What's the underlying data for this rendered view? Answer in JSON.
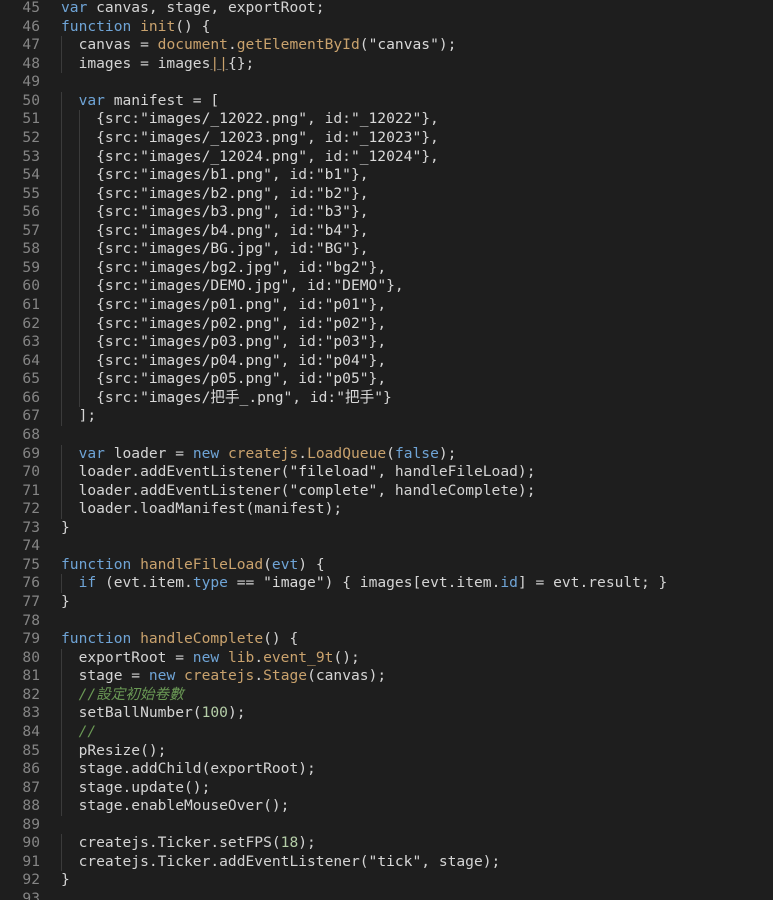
{
  "editor": {
    "colors": {
      "background": "#1e1e1e",
      "line_number": "#858585",
      "text": "#d4d4d4",
      "keyword": "#6fa4d6",
      "function": "#c9a26d",
      "number": "#b5cea8",
      "comment": "#6a9955"
    },
    "lines": [
      {
        "n": "45",
        "indent": 0,
        "tokens": [
          [
            "k",
            "var"
          ],
          [
            "i",
            " canvas, stage, exportRoot;"
          ]
        ]
      },
      {
        "n": "46",
        "indent": 0,
        "tokens": [
          [
            "k",
            "function"
          ],
          [
            "i",
            " "
          ],
          [
            "f",
            "init"
          ],
          [
            "p",
            "() {"
          ]
        ]
      },
      {
        "n": "47",
        "indent": 1,
        "tokens": [
          [
            "i",
            "  canvas = "
          ],
          [
            "f",
            "document"
          ],
          [
            "p",
            "."
          ],
          [
            "f",
            "getElementById"
          ],
          [
            "p",
            "("
          ],
          [
            "s",
            "\"canvas\""
          ],
          [
            "p",
            ");"
          ]
        ]
      },
      {
        "n": "48",
        "indent": 1,
        "tokens": [
          [
            "i",
            "  images = images"
          ],
          [
            "u",
            "||"
          ],
          [
            "p",
            "{};"
          ]
        ]
      },
      {
        "n": "49",
        "indent": 0,
        "tokens": []
      },
      {
        "n": "50",
        "indent": 1,
        "tokens": [
          [
            "i",
            "  "
          ],
          [
            "k",
            "var"
          ],
          [
            "i",
            " manifest = ["
          ]
        ]
      },
      {
        "n": "51",
        "indent": 2,
        "tokens": [
          [
            "i",
            "    {src:"
          ],
          [
            "s",
            "\"images/_12022.png\""
          ],
          [
            "i",
            ", id:"
          ],
          [
            "s",
            "\"_12022\""
          ],
          [
            "i",
            "},"
          ]
        ]
      },
      {
        "n": "52",
        "indent": 2,
        "tokens": [
          [
            "i",
            "    {src:"
          ],
          [
            "s",
            "\"images/_12023.png\""
          ],
          [
            "i",
            ", id:"
          ],
          [
            "s",
            "\"_12023\""
          ],
          [
            "i",
            "},"
          ]
        ]
      },
      {
        "n": "53",
        "indent": 2,
        "tokens": [
          [
            "i",
            "    {src:"
          ],
          [
            "s",
            "\"images/_12024.png\""
          ],
          [
            "i",
            ", id:"
          ],
          [
            "s",
            "\"_12024\""
          ],
          [
            "i",
            "},"
          ]
        ]
      },
      {
        "n": "54",
        "indent": 2,
        "tokens": [
          [
            "i",
            "    {src:"
          ],
          [
            "s",
            "\"images/b1.png\""
          ],
          [
            "i",
            ", id:"
          ],
          [
            "s",
            "\"b1\""
          ],
          [
            "i",
            "},"
          ]
        ]
      },
      {
        "n": "55",
        "indent": 2,
        "tokens": [
          [
            "i",
            "    {src:"
          ],
          [
            "s",
            "\"images/b2.png\""
          ],
          [
            "i",
            ", id:"
          ],
          [
            "s",
            "\"b2\""
          ],
          [
            "i",
            "},"
          ]
        ]
      },
      {
        "n": "56",
        "indent": 2,
        "tokens": [
          [
            "i",
            "    {src:"
          ],
          [
            "s",
            "\"images/b3.png\""
          ],
          [
            "i",
            ", id:"
          ],
          [
            "s",
            "\"b3\""
          ],
          [
            "i",
            "},"
          ]
        ]
      },
      {
        "n": "57",
        "indent": 2,
        "tokens": [
          [
            "i",
            "    {src:"
          ],
          [
            "s",
            "\"images/b4.png\""
          ],
          [
            "i",
            ", id:"
          ],
          [
            "s",
            "\"b4\""
          ],
          [
            "i",
            "},"
          ]
        ]
      },
      {
        "n": "58",
        "indent": 2,
        "tokens": [
          [
            "i",
            "    {src:"
          ],
          [
            "s",
            "\"images/BG.jpg\""
          ],
          [
            "i",
            ", id:"
          ],
          [
            "s",
            "\"BG\""
          ],
          [
            "i",
            "},"
          ]
        ]
      },
      {
        "n": "59",
        "indent": 2,
        "tokens": [
          [
            "i",
            "    {src:"
          ],
          [
            "s",
            "\"images/bg2.jpg\""
          ],
          [
            "i",
            ", id:"
          ],
          [
            "s",
            "\"bg2\""
          ],
          [
            "i",
            "},"
          ]
        ]
      },
      {
        "n": "60",
        "indent": 2,
        "tokens": [
          [
            "i",
            "    {src:"
          ],
          [
            "s",
            "\"images/DEMO.jpg\""
          ],
          [
            "i",
            ", id:"
          ],
          [
            "s",
            "\"DEMO\""
          ],
          [
            "i",
            "},"
          ]
        ]
      },
      {
        "n": "61",
        "indent": 2,
        "tokens": [
          [
            "i",
            "    {src:"
          ],
          [
            "s",
            "\"images/p01.png\""
          ],
          [
            "i",
            ", id:"
          ],
          [
            "s",
            "\"p01\""
          ],
          [
            "i",
            "},"
          ]
        ]
      },
      {
        "n": "62",
        "indent": 2,
        "tokens": [
          [
            "i",
            "    {src:"
          ],
          [
            "s",
            "\"images/p02.png\""
          ],
          [
            "i",
            ", id:"
          ],
          [
            "s",
            "\"p02\""
          ],
          [
            "i",
            "},"
          ]
        ]
      },
      {
        "n": "63",
        "indent": 2,
        "tokens": [
          [
            "i",
            "    {src:"
          ],
          [
            "s",
            "\"images/p03.png\""
          ],
          [
            "i",
            ", id:"
          ],
          [
            "s",
            "\"p03\""
          ],
          [
            "i",
            "},"
          ]
        ]
      },
      {
        "n": "64",
        "indent": 2,
        "tokens": [
          [
            "i",
            "    {src:"
          ],
          [
            "s",
            "\"images/p04.png\""
          ],
          [
            "i",
            ", id:"
          ],
          [
            "s",
            "\"p04\""
          ],
          [
            "i",
            "},"
          ]
        ]
      },
      {
        "n": "65",
        "indent": 2,
        "tokens": [
          [
            "i",
            "    {src:"
          ],
          [
            "s",
            "\"images/p05.png\""
          ],
          [
            "i",
            ", id:"
          ],
          [
            "s",
            "\"p05\""
          ],
          [
            "i",
            "},"
          ]
        ]
      },
      {
        "n": "66",
        "indent": 2,
        "tokens": [
          [
            "i",
            "    {src:"
          ],
          [
            "s",
            "\"images/把手_.png\""
          ],
          [
            "i",
            ", id:"
          ],
          [
            "s",
            "\"把手\""
          ],
          [
            "i",
            "}"
          ]
        ]
      },
      {
        "n": "67",
        "indent": 1,
        "tokens": [
          [
            "i",
            "  ];"
          ]
        ]
      },
      {
        "n": "68",
        "indent": 0,
        "tokens": []
      },
      {
        "n": "69",
        "indent": 1,
        "tokens": [
          [
            "i",
            "  "
          ],
          [
            "k",
            "var"
          ],
          [
            "i",
            " loader = "
          ],
          [
            "k",
            "new"
          ],
          [
            "i",
            " "
          ],
          [
            "f",
            "createjs"
          ],
          [
            "p",
            "."
          ],
          [
            "f",
            "LoadQueue"
          ],
          [
            "p",
            "("
          ],
          [
            "k",
            "false"
          ],
          [
            "p",
            ");"
          ]
        ]
      },
      {
        "n": "70",
        "indent": 1,
        "tokens": [
          [
            "i",
            "  loader.addEventListener("
          ],
          [
            "s",
            "\"fileload\""
          ],
          [
            "i",
            ", handleFileLoad);"
          ]
        ]
      },
      {
        "n": "71",
        "indent": 1,
        "tokens": [
          [
            "i",
            "  loader.addEventListener("
          ],
          [
            "s",
            "\"complete\""
          ],
          [
            "i",
            ", handleComplete);"
          ]
        ]
      },
      {
        "n": "72",
        "indent": 1,
        "tokens": [
          [
            "i",
            "  loader.loadManifest(manifest);"
          ]
        ]
      },
      {
        "n": "73",
        "indent": 0,
        "tokens": [
          [
            "i",
            "}"
          ]
        ]
      },
      {
        "n": "74",
        "indent": 0,
        "tokens": []
      },
      {
        "n": "75",
        "indent": 0,
        "tokens": [
          [
            "k",
            "function"
          ],
          [
            "i",
            " "
          ],
          [
            "f",
            "handleFileLoad"
          ],
          [
            "p",
            "("
          ],
          [
            "k",
            "evt"
          ],
          [
            "p",
            ") {"
          ]
        ]
      },
      {
        "n": "76",
        "indent": 1,
        "tokens": [
          [
            "i",
            "  "
          ],
          [
            "k",
            "if"
          ],
          [
            "i",
            " (evt.item."
          ],
          [
            "k",
            "type"
          ],
          [
            "i",
            " == "
          ],
          [
            "s",
            "\"image\""
          ],
          [
            "i",
            ") { images[evt.item."
          ],
          [
            "k",
            "id"
          ],
          [
            "i",
            "] = evt.result; }"
          ]
        ]
      },
      {
        "n": "77",
        "indent": 0,
        "tokens": [
          [
            "i",
            "}"
          ]
        ]
      },
      {
        "n": "78",
        "indent": 0,
        "tokens": []
      },
      {
        "n": "79",
        "indent": 0,
        "tokens": [
          [
            "k",
            "function"
          ],
          [
            "i",
            " "
          ],
          [
            "f",
            "handleComplete"
          ],
          [
            "p",
            "() {"
          ]
        ]
      },
      {
        "n": "80",
        "indent": 1,
        "tokens": [
          [
            "i",
            "  exportRoot = "
          ],
          [
            "k",
            "new"
          ],
          [
            "i",
            " "
          ],
          [
            "f",
            "lib"
          ],
          [
            "p",
            "."
          ],
          [
            "f",
            "event_9t"
          ],
          [
            "p",
            "();"
          ]
        ]
      },
      {
        "n": "81",
        "indent": 1,
        "tokens": [
          [
            "i",
            "  stage = "
          ],
          [
            "k",
            "new"
          ],
          [
            "i",
            " "
          ],
          [
            "f",
            "createjs"
          ],
          [
            "p",
            "."
          ],
          [
            "f",
            "Stage"
          ],
          [
            "p",
            "(canvas);"
          ]
        ]
      },
      {
        "n": "82",
        "indent": 1,
        "tokens": [
          [
            "i",
            "  "
          ],
          [
            "c",
            "//設定初始卷數"
          ]
        ]
      },
      {
        "n": "83",
        "indent": 1,
        "tokens": [
          [
            "i",
            "  setBallNumber("
          ],
          [
            "n",
            "100"
          ],
          [
            "i",
            ");"
          ]
        ]
      },
      {
        "n": "84",
        "indent": 1,
        "tokens": [
          [
            "i",
            "  "
          ],
          [
            "c",
            "//"
          ]
        ]
      },
      {
        "n": "85",
        "indent": 1,
        "tokens": [
          [
            "i",
            "  pResize();"
          ]
        ]
      },
      {
        "n": "86",
        "indent": 1,
        "tokens": [
          [
            "i",
            "  stage.addChild(exportRoot);"
          ]
        ]
      },
      {
        "n": "87",
        "indent": 1,
        "tokens": [
          [
            "i",
            "  stage.update();"
          ]
        ]
      },
      {
        "n": "88",
        "indent": 1,
        "tokens": [
          [
            "i",
            "  stage.enableMouseOver();"
          ]
        ]
      },
      {
        "n": "89",
        "indent": 0,
        "tokens": []
      },
      {
        "n": "90",
        "indent": 1,
        "tokens": [
          [
            "i",
            "  createjs.Ticker.setFPS("
          ],
          [
            "n",
            "18"
          ],
          [
            "i",
            ");"
          ]
        ]
      },
      {
        "n": "91",
        "indent": 1,
        "tokens": [
          [
            "i",
            "  createjs.Ticker.addEventListener("
          ],
          [
            "s",
            "\"tick\""
          ],
          [
            "i",
            ", stage);"
          ]
        ]
      },
      {
        "n": "92",
        "indent": 0,
        "tokens": [
          [
            "i",
            "}"
          ]
        ]
      },
      {
        "n": "93",
        "indent": 0,
        "tokens": []
      }
    ]
  }
}
